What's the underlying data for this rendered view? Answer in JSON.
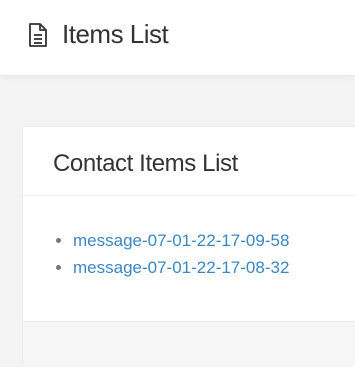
{
  "header": {
    "icon": "document-icon",
    "title": "Items List"
  },
  "card": {
    "title": "Contact Items List",
    "items": [
      {
        "label": "message-07-01-22-17-09-58"
      },
      {
        "label": "message-07-01-22-17-08-32"
      }
    ]
  },
  "colors": {
    "link": "#3a87c6",
    "text": "#333333",
    "background": "#f3f3f3"
  }
}
